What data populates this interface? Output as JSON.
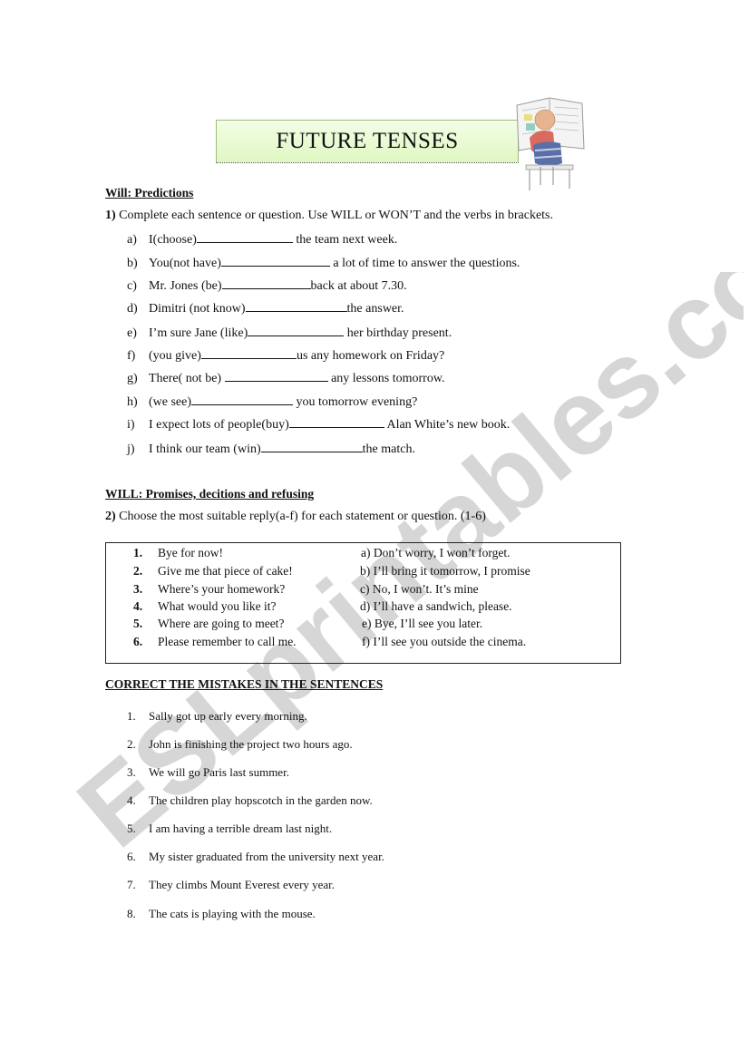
{
  "title": "FUTURE TENSES",
  "section1": {
    "heading": "Will: Predictions",
    "instruction_num": "1)",
    "instruction": " Complete each sentence or question. Use WILL or WON’T and the verbs in brackets.",
    "items": [
      {
        "label": "a)",
        "before": "I(choose)",
        "after": " the team next week."
      },
      {
        "label": "b)",
        "before": "You(not have)",
        "after": " a lot of time to answer the questions."
      },
      {
        "label": "c)",
        "before": "Mr. Jones (be)",
        "after": "back at about 7.30."
      },
      {
        "label": "d)",
        "before": "Dimitri (not know)",
        "after": "the answer."
      },
      {
        "label": "e)",
        "before": "I’m sure Jane (like)",
        "after": " her birthday present."
      },
      {
        "label": "f)",
        "before": "(you give)",
        "after": "us any homework on Friday?"
      },
      {
        "label": "g)",
        "before": "There( not be) ",
        "after": " any lessons tomorrow."
      },
      {
        "label": "h)",
        "before": "(we see)",
        "after": " you tomorrow evening?"
      },
      {
        "label": "i)",
        "before": "I expect lots of people(buy)",
        "after": " Alan White’s new book."
      },
      {
        "label": "j)",
        "before": "I think our team (win)",
        "after": "the match."
      }
    ]
  },
  "section2": {
    "heading": "WILL: Promises, decitions and refusing",
    "instruction_num": "2)",
    "instruction": " Choose the most suitable reply(a-f) for each statement or question. (1-6)",
    "statements": [
      {
        "num": "1.",
        "text": "Bye for now!"
      },
      {
        "num": "2.",
        "text": "Give me that piece of cake!"
      },
      {
        "num": "3.",
        "text": "Where’s your homework?"
      },
      {
        "num": "4.",
        "text": "What would you like it?"
      },
      {
        "num": "5.",
        "text": "Where are going to meet?"
      },
      {
        "num": "6.",
        "text": "Please remember to call me."
      }
    ],
    "replies": [
      "a) Don’t worry, I won’t forget.",
      "b) I’ll bring it tomorrow, I promise",
      "c) No, I won’t. It’s mine",
      "d) I’ll have a sandwich, please.",
      "e) Bye, I’ll see you later.",
      "f) I’ll see you outside the cinema."
    ]
  },
  "section3": {
    "heading": "CORRECT THE MISTAKES IN THE SENTENCES",
    "items": [
      {
        "num": "1.",
        "text": "Sally got up early every morning."
      },
      {
        "num": "2.",
        "text": "John is finishing the project two hours ago."
      },
      {
        "num": "3.",
        "text": "We will go Paris last summer."
      },
      {
        "num": "4.",
        "text": "The children play hopscotch in the garden now."
      },
      {
        "num": "5.",
        "text": "I am having a terrible dream last night."
      },
      {
        "num": "6.",
        "text": "My sister graduated from the university next year."
      },
      {
        "num": "7.",
        "text": "They climbs Mount Everest every year."
      },
      {
        "num": "8.",
        "text": "The cats is playing with the mouse."
      }
    ]
  },
  "watermark": "ESLprintables.com",
  "colors": {
    "title_fill": "#dff7c2",
    "watermark": "#d0d0d0"
  }
}
